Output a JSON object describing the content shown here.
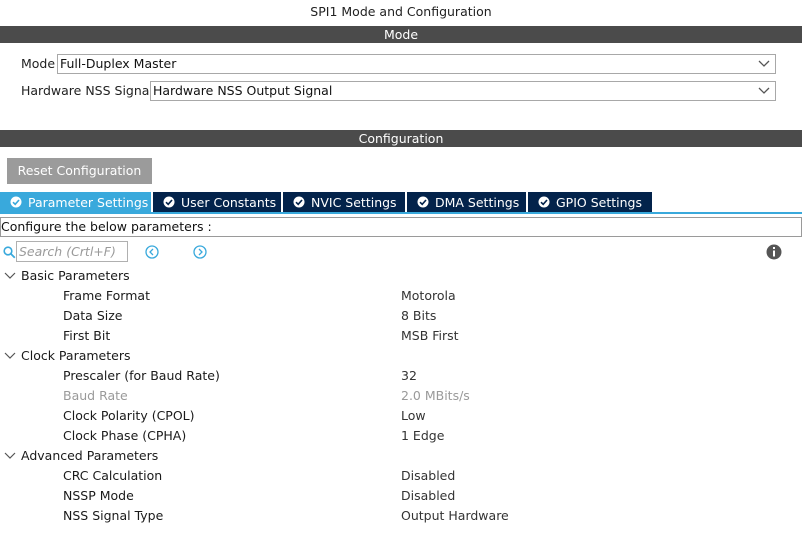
{
  "window": {
    "title": "SPI1 Mode and Configuration"
  },
  "mode_section": {
    "header": "Mode",
    "fields": [
      {
        "label": "Mode",
        "value": "Full-Duplex Master"
      },
      {
        "label": "Hardware NSS Signal",
        "value": "Hardware NSS Output Signal"
      }
    ]
  },
  "config_section": {
    "header": "Configuration",
    "reset_label": "Reset Configuration",
    "tabs": [
      {
        "label": "Parameter Settings",
        "active": true
      },
      {
        "label": "User Constants",
        "active": false
      },
      {
        "label": "NVIC Settings",
        "active": false
      },
      {
        "label": "DMA Settings",
        "active": false
      },
      {
        "label": "GPIO Settings",
        "active": false
      }
    ],
    "instructions": "Configure the below parameters :",
    "search_placeholder": "Search (Crtl+F)",
    "groups": [
      {
        "label": "Basic Parameters",
        "params": [
          {
            "name": "Frame Format",
            "value": "Motorola",
            "disabled": false
          },
          {
            "name": "Data Size",
            "value": "8 Bits",
            "disabled": false
          },
          {
            "name": "First Bit",
            "value": "MSB First",
            "disabled": false
          }
        ]
      },
      {
        "label": "Clock Parameters",
        "params": [
          {
            "name": "Prescaler (for Baud Rate)",
            "value": "32",
            "disabled": false
          },
          {
            "name": "Baud Rate",
            "value": "2.0 MBits/s",
            "disabled": true
          },
          {
            "name": "Clock Polarity (CPOL)",
            "value": "Low",
            "disabled": false
          },
          {
            "name": "Clock Phase (CPHA)",
            "value": "1 Edge",
            "disabled": false
          }
        ]
      },
      {
        "label": "Advanced Parameters",
        "params": [
          {
            "name": "CRC Calculation",
            "value": "Disabled",
            "disabled": false
          },
          {
            "name": "NSSP Mode",
            "value": "Disabled",
            "disabled": false
          },
          {
            "name": "NSS Signal Type",
            "value": "Output Hardware",
            "disabled": false
          }
        ]
      }
    ]
  },
  "colors": {
    "header_bg": "#4b4b4b",
    "tab_bg": "#03234b",
    "tab_active_bg": "#39a9dc",
    "accent": "#39a9dc",
    "reset_bg": "#9b9b9b"
  },
  "icons": {
    "search": "search-icon",
    "prev": "chevron-left-circle-icon",
    "next": "chevron-right-circle-icon",
    "info": "info-icon",
    "expand": "chevron-down-icon",
    "tab_check": "check-circle-icon"
  }
}
